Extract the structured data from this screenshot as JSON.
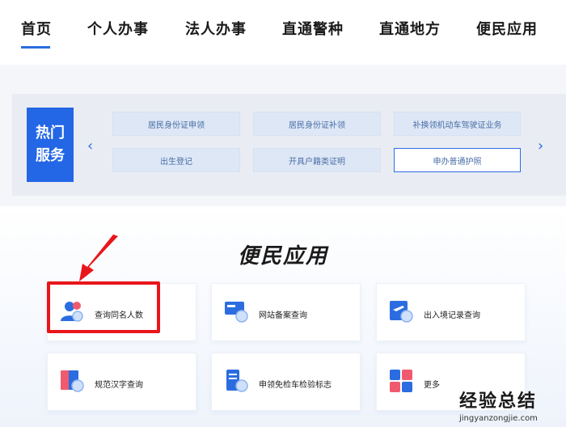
{
  "nav": {
    "items": [
      "首页",
      "个人办事",
      "法人办事",
      "直通警种",
      "直通地方",
      "便民应用"
    ]
  },
  "hot": {
    "badge_line1": "热门",
    "badge_line2": "服务",
    "prev_icon": "chevron-left-icon",
    "next_icon": "chevron-right-icon",
    "items": [
      "居民身份证申领",
      "居民身份证补领",
      "补换领机动车驾驶证业务",
      "出生登记",
      "开具户籍类证明",
      "申办普通护照"
    ]
  },
  "apps": {
    "title": "便民应用",
    "cards": [
      {
        "label": "查询同名人数",
        "icon": "user-search-icon"
      },
      {
        "label": "网站备案查询",
        "icon": "website-record-icon"
      },
      {
        "label": "出入境记录查询",
        "icon": "flight-record-icon"
      },
      {
        "label": "规范汉字查询",
        "icon": "book-search-icon"
      },
      {
        "label": "申领免检车检验标志",
        "icon": "vehicle-document-icon"
      },
      {
        "label": "更多",
        "icon": "grid-more-icon"
      }
    ]
  },
  "watermark": {
    "text": "经验总结",
    "url": "jingyanzongjie.com"
  },
  "colors": {
    "accent": "#2366e6",
    "highlight": "#e8161b"
  }
}
